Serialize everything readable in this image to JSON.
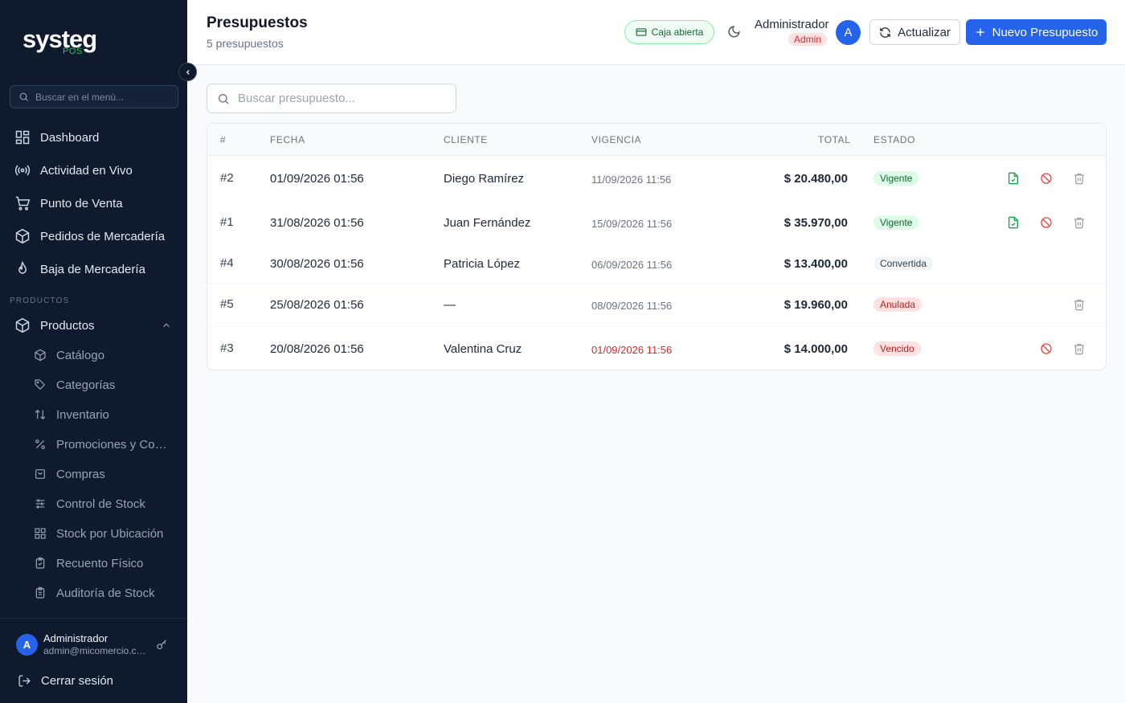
{
  "sidebar": {
    "brand": "systeg",
    "brand_sub": "POS",
    "search_placeholder": "Buscar en el menú...",
    "items": [
      {
        "label": "Dashboard"
      },
      {
        "label": "Actividad en Vivo"
      },
      {
        "label": "Punto de Venta"
      },
      {
        "label": "Pedidos de Mercadería"
      },
      {
        "label": "Baja de Mercadería"
      }
    ],
    "section_label": "PRODUCTOS",
    "group_label": "Productos",
    "sub_items": [
      {
        "label": "Catálogo"
      },
      {
        "label": "Categorías"
      },
      {
        "label": "Inventario"
      },
      {
        "label": "Promociones y Combos"
      },
      {
        "label": "Compras"
      },
      {
        "label": "Control de Stock"
      },
      {
        "label": "Stock por Ubicación"
      },
      {
        "label": "Recuento Físico"
      },
      {
        "label": "Auditoría de Stock"
      }
    ],
    "user": {
      "initial": "A",
      "name": "Administrador",
      "email": "admin@micomercio.com"
    },
    "logout_label": "Cerrar sesión"
  },
  "header": {
    "title": "Presupuestos",
    "subtitle": "5 presupuestos",
    "caja_label": "Caja abierta",
    "admin_name": "Administrador",
    "admin_role": "Admin",
    "avatar_initial": "A",
    "refresh_label": "Actualizar",
    "new_label": "Nuevo Presupuesto"
  },
  "search": {
    "placeholder": "Buscar presupuesto..."
  },
  "table": {
    "columns": [
      "#",
      "FECHA",
      "CLIENTE",
      "VIGENCIA",
      "TOTAL",
      "ESTADO"
    ],
    "rows": [
      {
        "id": "#2",
        "fecha": "01/09/2026 01:56",
        "cliente": "Diego Ramírez",
        "vigencia": "11/09/2026 11:56",
        "total": "$ 20.480,00",
        "estado": "Vigente"
      },
      {
        "id": "#1",
        "fecha": "31/08/2026 01:56",
        "cliente": "Juan Fernández",
        "vigencia": "15/09/2026 11:56",
        "total": "$ 35.970,00",
        "estado": "Vigente"
      },
      {
        "id": "#4",
        "fecha": "30/08/2026 01:56",
        "cliente": "Patricia López",
        "vigencia": "06/09/2026 11:56",
        "total": "$ 13.400,00",
        "estado": "Convertida"
      },
      {
        "id": "#5",
        "fecha": "25/08/2026 01:56",
        "cliente": "—",
        "vigencia": "08/09/2026 11:56",
        "total": "$ 19.960,00",
        "estado": "Anulada"
      },
      {
        "id": "#3",
        "fecha": "20/08/2026 01:56",
        "cliente": "Valentina Cruz",
        "vigencia": "01/09/2026 11:56",
        "total": "$ 14.000,00",
        "estado": "Vencido"
      }
    ]
  },
  "colors": {
    "sidebar_bg": "#0f1a2e",
    "primary": "#2563eb",
    "success": "#22c55e",
    "danger": "#dc2626"
  }
}
